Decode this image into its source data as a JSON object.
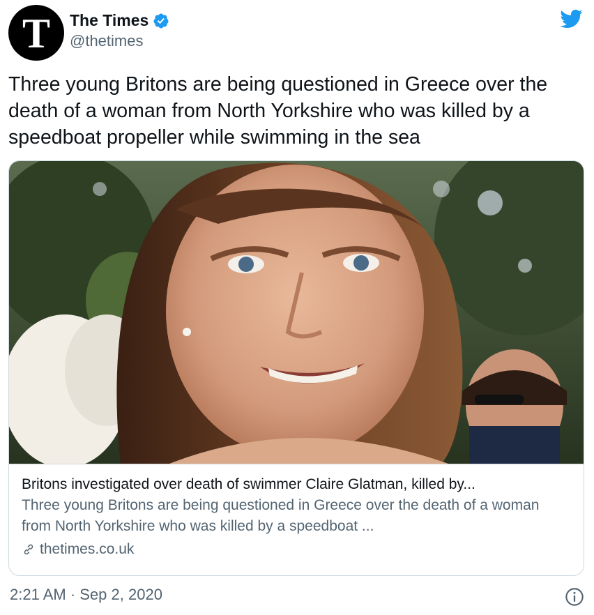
{
  "author": {
    "avatar_letter": "T",
    "name": "The Times",
    "handle": "@thetimes",
    "verified": true
  },
  "tweet": {
    "text": "Three young Britons are being questioned in Greece over the death of a woman from North Yorkshire who was killed by a speedboat propeller while swimming in the sea"
  },
  "card": {
    "title": "Britons investigated over death of swimmer Claire Glatman, killed by...",
    "description": "Three young Britons are being questioned in Greece over the death of a woman from North Yorkshire who was killed by a speedboat ...",
    "domain": "thetimes.co.uk"
  },
  "footer": {
    "timestamp": "2:21 AM · Sep 2, 2020"
  },
  "icons": {
    "brand": "twitter-bird-icon",
    "verified": "verified-badge-icon",
    "link": "link-icon",
    "info": "info-icon"
  },
  "colors": {
    "twitter_blue": "#1d9bf0",
    "text_primary": "#0f1419",
    "text_secondary": "#536471",
    "border": "#cfd9de"
  }
}
